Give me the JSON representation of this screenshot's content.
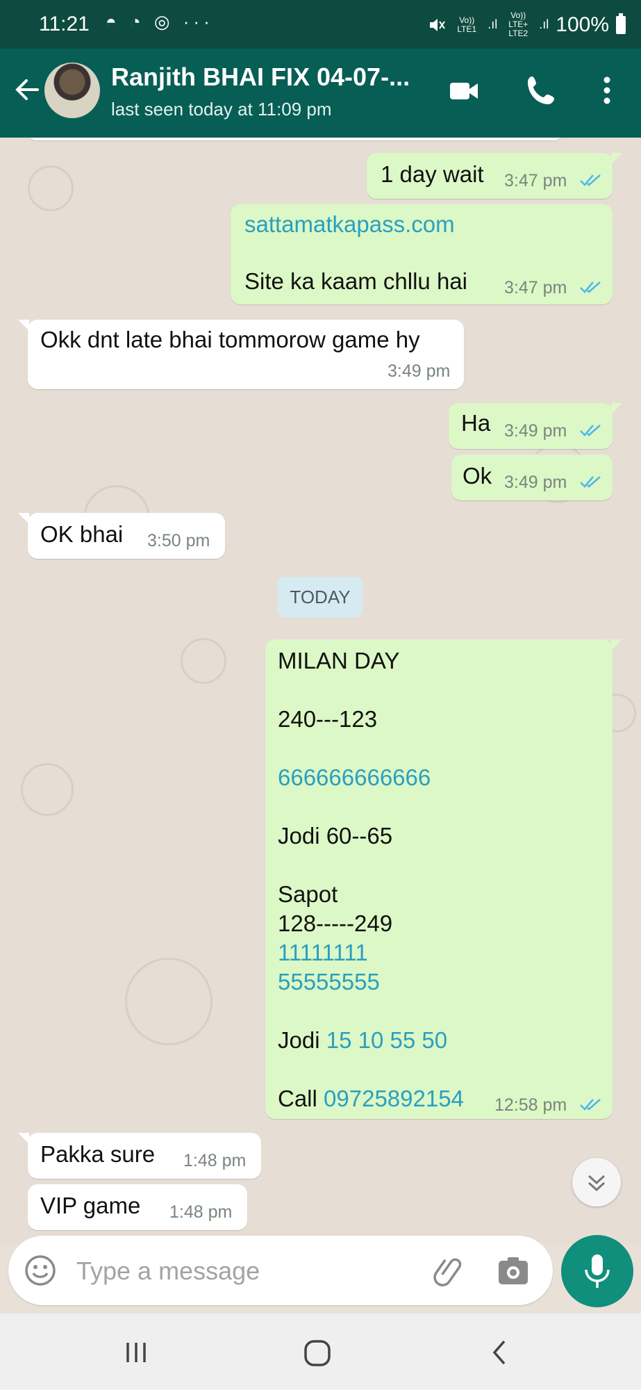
{
  "status_bar": {
    "time": "11:21",
    "notification_icons": "◓ ◔ ◎ ···",
    "net1_top": "Vo)) LTE1",
    "net2_top": "Vo)) LTE+ LTE2",
    "battery": "100%"
  },
  "header": {
    "contact_name": "Ranjith BHAI FIX 04-07-...",
    "last_seen": "last seen today at 11:09 pm",
    "icons": [
      "back-arrow-icon",
      "video-call-icon",
      "phone-icon",
      "more-vert-icon"
    ]
  },
  "messages": [
    {
      "dir": "out",
      "text": "1 day wait",
      "time": "3:47 pm"
    },
    {
      "dir": "out",
      "link": "sattamatkapass.com",
      "text": "Site ka kaam chllu hai",
      "time": "3:47 pm"
    },
    {
      "dir": "in",
      "text": "Okk dnt late bhai tommorow game hy",
      "time": "3:49 pm"
    },
    {
      "dir": "out",
      "text": "Ha",
      "time": "3:49 pm"
    },
    {
      "dir": "out",
      "text": "Ok",
      "time": "3:49 pm"
    },
    {
      "dir": "in",
      "text": "OK bhai",
      "time": "3:50 pm"
    },
    {
      "dir": "out",
      "lines": {
        "l1": "MILAN  DAY",
        "l2": "240---123",
        "l3": "666666666666",
        "l4": "Jodi 60--65",
        "l5": "Sapot",
        "l6": "128-----249",
        "l7": "11111111",
        "l8": "55555555",
        "l9_prefix": "Jodi ",
        "l9_link": "15 10 55 50",
        "l10_prefix": "Call ",
        "l10_link": "09725892154"
      },
      "time": "12:58 pm"
    },
    {
      "dir": "in",
      "text": "Pakka sure",
      "time": "1:48 pm"
    },
    {
      "dir": "in",
      "text": "VIP game",
      "time": "1:48 pm"
    }
  ],
  "date_chip": "TODAY",
  "composer": {
    "placeholder": "Type a message"
  },
  "colors": {
    "header": "#075e54",
    "outgoing": "#dcf8c6",
    "incoming": "#ffffff",
    "link": "#2a9fbf",
    "ticks": "#4fb6ec",
    "mic": "#0f8f7c"
  }
}
